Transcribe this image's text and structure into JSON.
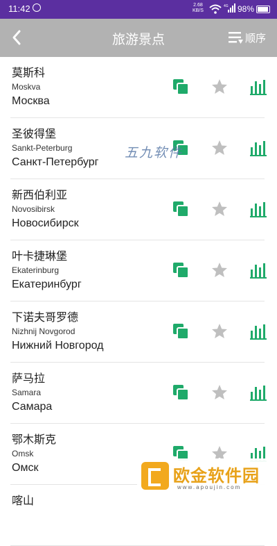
{
  "status_bar": {
    "time": "11:42",
    "net_speed": "2.68",
    "net_unit": "KB/S",
    "network": "4G",
    "battery": "98%"
  },
  "header": {
    "title": "旅游景点",
    "sort_label": "顺序"
  },
  "items": [
    {
      "zh": "莫斯科",
      "lat": "Moskva",
      "ru": "Москва"
    },
    {
      "zh": "圣彼得堡",
      "lat": "Sankt-Peterburg",
      "ru": "Санкт-Петербург"
    },
    {
      "zh": "新西伯利亚",
      "lat": "Novosibirsk",
      "ru": "Новосибирск"
    },
    {
      "zh": "叶卡捷琳堡",
      "lat": "Ekaterinburg",
      "ru": "Екатеринбург"
    },
    {
      "zh": "下诺夫哥罗德",
      "lat": "Nizhnij Novgorod",
      "ru": "Нижний Новгород"
    },
    {
      "zh": "萨马拉",
      "lat": "Samara",
      "ru": "Самара"
    },
    {
      "zh": "鄂木斯克",
      "lat": "Omsk",
      "ru": "Омск"
    },
    {
      "zh": "喀山",
      "lat": "",
      "ru": ""
    }
  ],
  "watermark": "五九软件",
  "logo": {
    "name": "欧金软件园",
    "url": "www.apoujin.com"
  },
  "colors": {
    "accent_green": "#1faa6a",
    "star_gray": "#bfbfbf",
    "status_bar": "#5b2fa0",
    "toolbar": "#b2b2b2"
  }
}
